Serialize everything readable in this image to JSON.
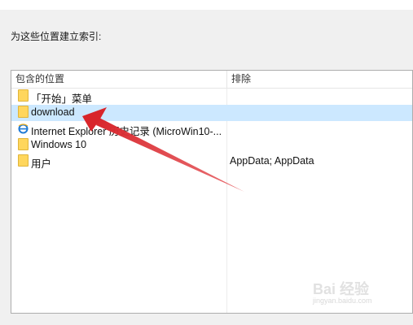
{
  "dialog": {
    "heading": "为这些位置建立索引:"
  },
  "list": {
    "columns": {
      "location": "包含的位置",
      "exclude": "排除"
    },
    "rows": [
      {
        "name": "「开始」菜单",
        "exclude": "",
        "icon": "folder-icon"
      },
      {
        "name": "download",
        "exclude": "",
        "icon": "folder-icon",
        "selected": true
      },
      {
        "name": "Internet Explorer 历史记录 (MicroWin10-...",
        "exclude": "",
        "icon": "internet-explorer-icon"
      },
      {
        "name": "Windows 10",
        "exclude": "",
        "icon": "folder-icon"
      },
      {
        "name": "用户",
        "exclude": "AppData; AppData",
        "icon": "folder-icon"
      }
    ]
  },
  "annotation": {
    "arrow_color": "#e0393e"
  },
  "watermark": {
    "text": "Bai 经验",
    "sub": "jingyan.baidu.com"
  }
}
